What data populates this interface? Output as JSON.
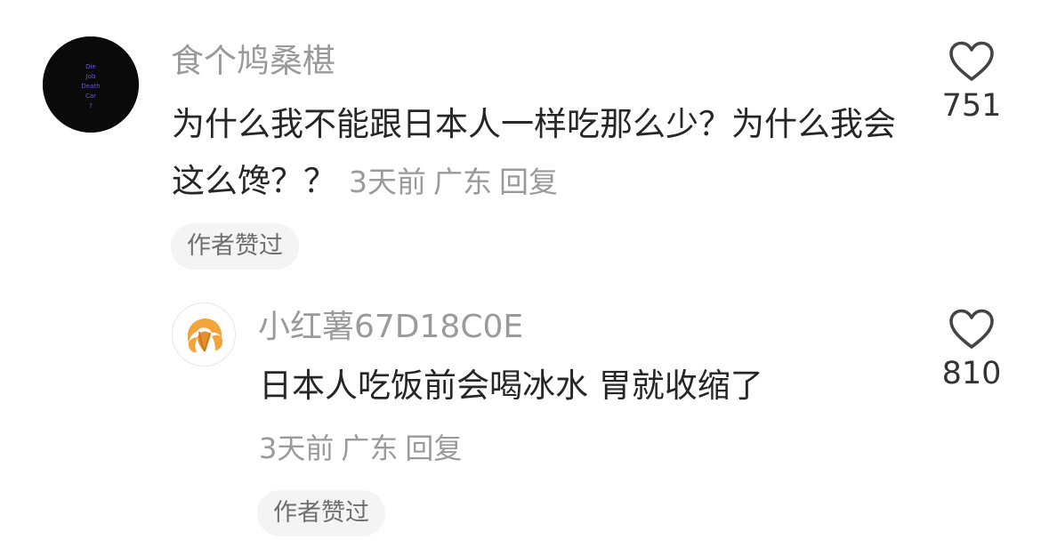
{
  "comments": [
    {
      "username": "食个鸠桑椹",
      "avatar_text": [
        "Die",
        "Job",
        "Death",
        "Car",
        "?"
      ],
      "text": "为什么我不能跟日本人一样吃那么少？为什么我会这么馋？？",
      "time": "3天前",
      "location": "广东",
      "reply_label": "回复",
      "badge": "作者赞过",
      "like_count": "751",
      "like_icon": "heart-outline-icon"
    },
    {
      "username": "小红薯67D18C0E",
      "avatar_icon": "croissant-icon",
      "text": "日本人吃饭前会喝冰水 胃就收缩了",
      "time": "3天前",
      "location": "广东",
      "reply_label": "回复",
      "badge": "作者赞过",
      "like_count": "810",
      "like_icon": "heart-outline-icon"
    }
  ],
  "colors": {
    "meta_text": "#9a9a9a",
    "body_text": "#262626",
    "badge_bg": "#f4f4f4",
    "avatar_text": "#6a57d8",
    "croissant": "#f2a43a"
  }
}
